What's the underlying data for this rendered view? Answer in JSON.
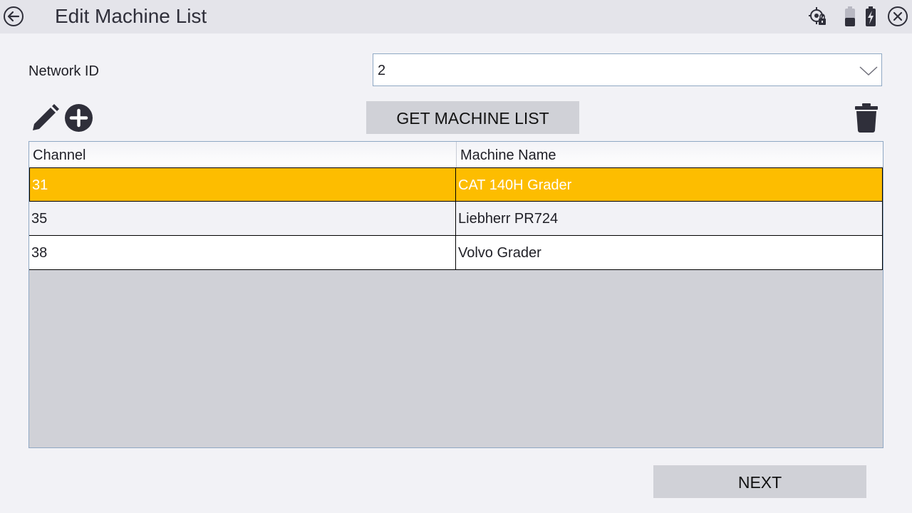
{
  "header": {
    "title": "Edit Machine List",
    "icons": [
      "back-arrow-icon",
      "gps-lock-icon",
      "battery-icon",
      "battery-charging-icon",
      "close-icon"
    ]
  },
  "network": {
    "label": "Network ID",
    "value": "2"
  },
  "toolbar": {
    "get_list_label": "GET MACHINE LIST",
    "icons": [
      "pencil-icon",
      "add-circle-icon",
      "trash-icon"
    ]
  },
  "table": {
    "headers": [
      "Channel",
      "Machine Name"
    ],
    "rows": [
      {
        "channel": "31",
        "name": "CAT 140H Grader",
        "selected": true
      },
      {
        "channel": "35",
        "name": "Liebherr PR724",
        "selected": false
      },
      {
        "channel": "38",
        "name": "Volvo Grader",
        "selected": false
      }
    ]
  },
  "footer": {
    "next_label": "NEXT"
  },
  "colors": {
    "selected_row": "#fdbd00",
    "button": "#d0d1d7",
    "titlebar": "#e4e4ea"
  }
}
